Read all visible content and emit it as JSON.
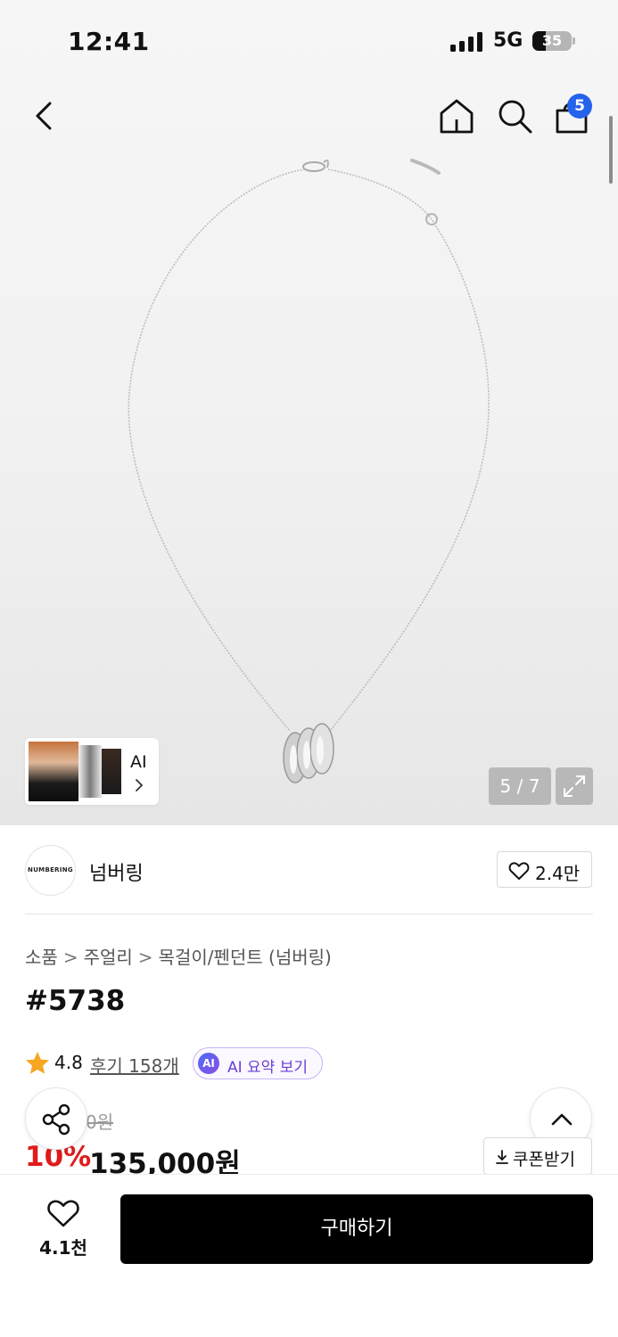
{
  "status_bar": {
    "time": "12:41",
    "network": "5G",
    "battery": "35",
    "battery_level": 0.35
  },
  "header": {
    "icons": [
      "back-icon",
      "home-icon",
      "search-icon",
      "shopping-bag-icon"
    ],
    "cart_count": "5"
  },
  "gallery": {
    "ai_lookbook_label": "AI",
    "page_counter": "5 / 7"
  },
  "brand": {
    "logo_text": "NUMBERING",
    "name": "넘버링",
    "like_count": "2.4만"
  },
  "breadcrumb": [
    "소품",
    "주얼리",
    "목걸이/펜던트 (넘버링)"
  ],
  "product": {
    "title": "#5738",
    "rating": "4.8",
    "review_link": "후기 158개",
    "ai_badge": "AI",
    "ai_summary_label": "AI 요약 보기",
    "original_price_visible": "0원",
    "discount": "10%",
    "sale_price": "135,000원",
    "coupon_label": "쿠폰받기"
  },
  "bottom_bar": {
    "wish_count": "4.1천",
    "buy_label": "구매하기"
  },
  "colors": {
    "accent_blue": "#2563eb",
    "discount_red": "#e01b1b",
    "ai_purple": "#6a3fd6",
    "star_orange": "#f5a623"
  }
}
